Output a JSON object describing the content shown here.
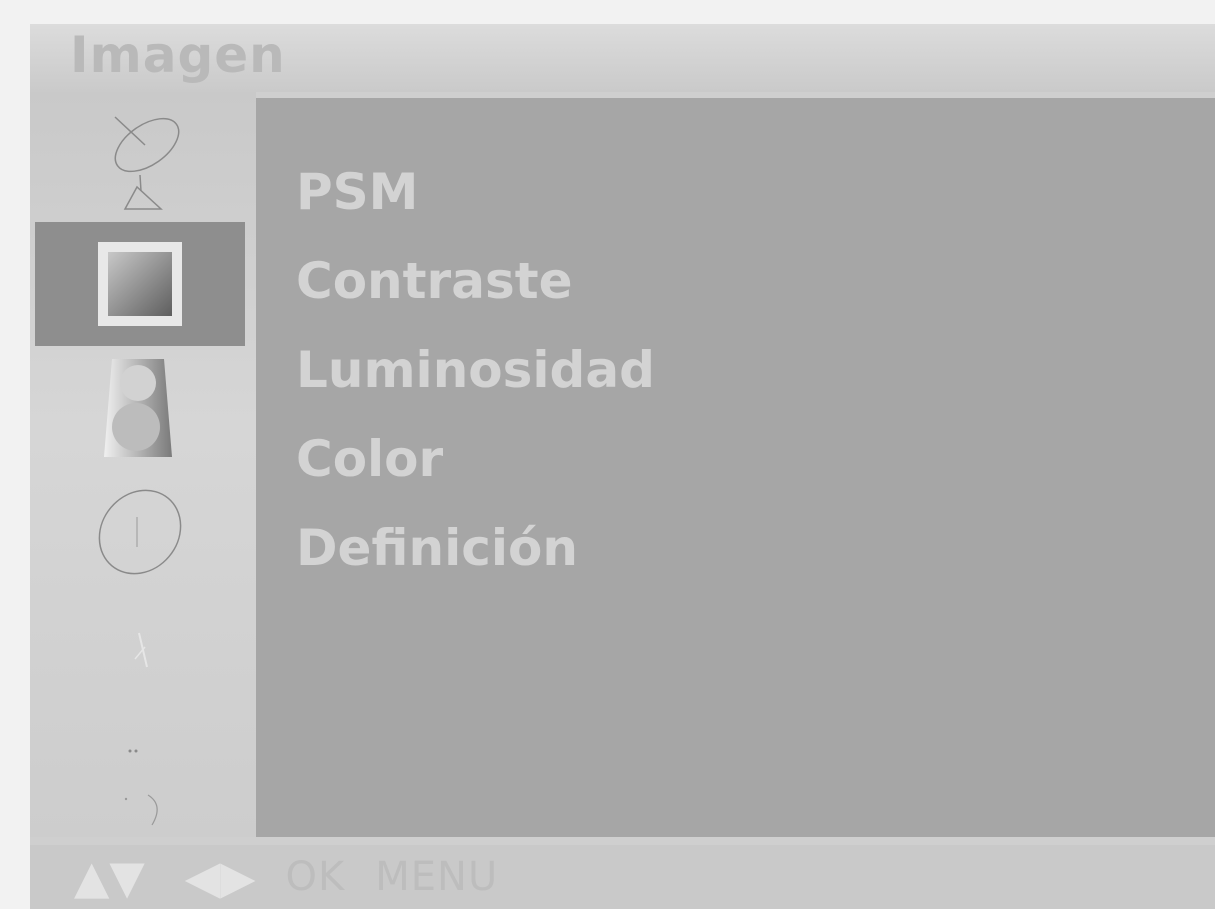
{
  "menu_title": "Imagen",
  "sidebar": {
    "icons": [
      {
        "name": "satellite-dish-icon",
        "selected": false
      },
      {
        "name": "picture-icon",
        "selected": true
      },
      {
        "name": "speaker-icon",
        "selected": false
      },
      {
        "name": "clock-icon",
        "selected": false
      },
      {
        "name": "option-icon",
        "selected": false
      },
      {
        "name": "screen-icon",
        "selected": false
      }
    ]
  },
  "menu_items": [
    "PSM",
    "Contraste",
    "Luminosidad",
    "Color",
    "Definición"
  ],
  "footer": {
    "up_down_arrows": "▲▼",
    "left_right_arrows": "◀▶",
    "ok_label": "OK",
    "menu_label": "MENU"
  }
}
